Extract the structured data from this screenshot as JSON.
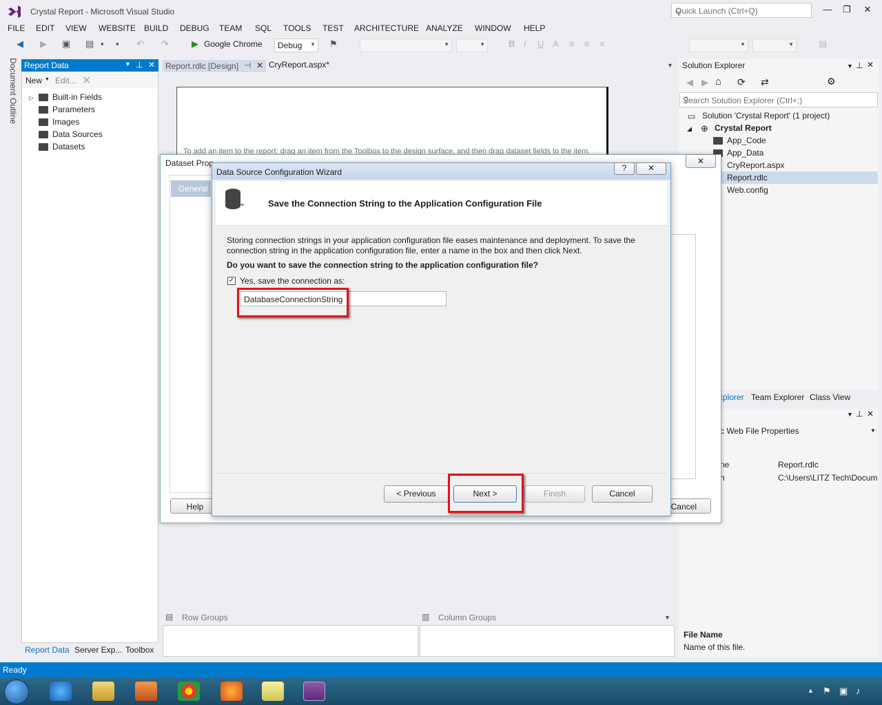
{
  "app": {
    "title": "Crystal Report - Microsoft Visual Studio",
    "quick_launch_placeholder": "Quick Launch (Ctrl+Q)"
  },
  "menu": [
    "FILE",
    "EDIT",
    "VIEW",
    "WEBSITE",
    "BUILD",
    "DEBUG",
    "TEAM",
    "SQL",
    "TOOLS",
    "TEST",
    "ARCHITECTURE",
    "ANALYZE",
    "WINDOW",
    "HELP"
  ],
  "toolbar": {
    "browser": "Google Chrome",
    "config": "Debug"
  },
  "side_strip": {
    "label": "Document Outline"
  },
  "report_data": {
    "title": "Report Data",
    "new_label": "New",
    "edit_label": "Edit...",
    "items": [
      "Built-in Fields",
      "Parameters",
      "Images",
      "Data Sources",
      "Datasets"
    ],
    "bottom_tabs": [
      "Report Data",
      "Server Exp...",
      "Toolbox"
    ]
  },
  "doc_tabs": [
    "Report.rdlc [Design]",
    "CryReport.aspx*"
  ],
  "design": {
    "hint": "To add an item to the report: drag an item from the Toolbox to the design surface, and then drag dataset fields to the item."
  },
  "groups": {
    "row": "Row Groups",
    "column": "Column Groups"
  },
  "solution_explorer": {
    "title": "Solution Explorer",
    "search_placeholder": "Search Solution Explorer (Ctrl+;)",
    "solution": "Solution 'Crystal Report' (1 project)",
    "project": "Crystal Report",
    "items": [
      "App_Code",
      "App_Data",
      "CryReport.aspx",
      "Report.rdlc",
      "Web.config"
    ],
    "selected": "Report.rdlc",
    "tabs": [
      "xplorer",
      "Team Explorer",
      "Class View"
    ]
  },
  "properties": {
    "header": "c  Web File Properties",
    "rows": [
      {
        "k": "ne",
        "v": "Report.rdlc"
      },
      {
        "k": "h",
        "v": "C:\\Users\\LITZ Tech\\Docum"
      }
    ],
    "desc_title": "File Name",
    "desc_text": "Name of this file."
  },
  "status": {
    "text": "Ready"
  },
  "dataset_dialog": {
    "title": "Dataset Prop",
    "tab": "General",
    "help": "Help",
    "cancel": "Cancel"
  },
  "wizard": {
    "title": "Data Source Configuration Wizard",
    "help": "?",
    "close": "✕",
    "heading": "Save the Connection String to the Application Configuration File",
    "description": "Storing connection strings in your application configuration file eases maintenance and deployment. To save the connection string in the application configuration file, enter a name in the box and then click Next.",
    "question": "Do you want to save the connection string to the application configuration file?",
    "checkbox_label": "Yes, save the connection as:",
    "checkbox_checked": true,
    "connection_name": "DatabaseConnectionString",
    "buttons": {
      "previous": "< Previous",
      "next": "Next >",
      "finish": "Finish",
      "cancel": "Cancel"
    }
  },
  "colors": {
    "accent": "#007acc",
    "highlight": "#e0141e"
  }
}
